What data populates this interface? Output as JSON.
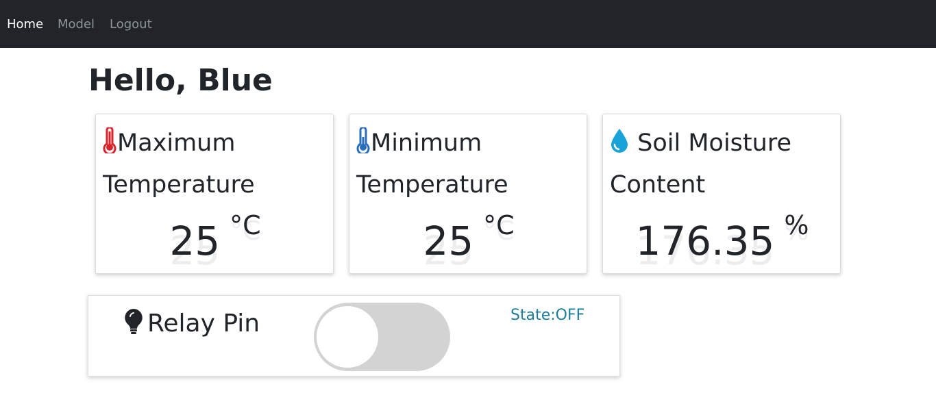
{
  "nav": {
    "items": [
      {
        "label": "Home",
        "active": true
      },
      {
        "label": "Model",
        "active": false
      },
      {
        "label": "Logout",
        "active": false
      }
    ]
  },
  "greeting": "Hello, Blue",
  "cards": [
    {
      "title": "Maximum Temperature",
      "icon": "thermometer-hot-icon",
      "value": "25",
      "unit": "°C"
    },
    {
      "title": "Minimum Temperature",
      "icon": "thermometer-cold-icon",
      "value": "25",
      "unit": "°C"
    },
    {
      "title": "Soil Moisture Content",
      "icon": "water-drop-icon",
      "value": "176.35",
      "unit": "%"
    }
  ],
  "relay": {
    "label": "Relay Pin",
    "icon": "lightbulb-icon",
    "state": "State:OFF",
    "on": false
  },
  "colors": {
    "navbar": "#212529",
    "nav_active": "#ffffff",
    "nav_inactive": "#8f949a",
    "hot": "#d9232d",
    "cold": "#2a6ebb",
    "water": "#1aa3d9",
    "state_text": "#1d7e9a",
    "toggle_off": "#d3d3d3"
  }
}
